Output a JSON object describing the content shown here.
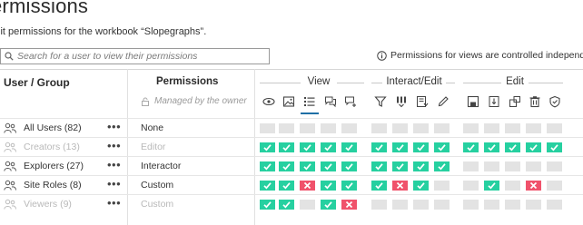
{
  "page": {
    "title": "ermissions",
    "subtitle": "lit permissions for the workbook “Slopegraphs”."
  },
  "search": {
    "placeholder": "Search for a user to view their permissions"
  },
  "notice": "Permissions for views are controlled independently",
  "table": {
    "user_group_header": "User / Group",
    "permissions_header": "Permissions",
    "managed_by_owner": "Managed by the owner",
    "categories": [
      {
        "label": "View"
      },
      {
        "label": "Interact/Edit"
      },
      {
        "label": "Edit"
      }
    ],
    "capabilities": [
      "view-icon",
      "image-icon",
      "filter-list-icon",
      "comments-icon",
      "add-comment-icon",
      "filter-icon",
      "columns-icon",
      "download-data-icon",
      "web-edit-icon",
      "save-icon",
      "download-workbook-icon",
      "move-icon",
      "delete-icon",
      "permissions-icon"
    ],
    "rows": [
      {
        "icon": "group-icon",
        "name": "All Users (82)",
        "role": "None",
        "dim": false,
        "cells": [
          "none",
          "none",
          "none",
          "none",
          "none",
          "none",
          "none",
          "none",
          "none",
          "none",
          "none",
          "none",
          "none",
          "none"
        ]
      },
      {
        "icon": "group-icon",
        "name": "Creators (13)",
        "role": "Editor",
        "dim": true,
        "cells": [
          "allow",
          "allow",
          "allow",
          "allow",
          "allow",
          "allow",
          "allow",
          "allow",
          "allow",
          "allow",
          "allow",
          "allow",
          "allow",
          "allow"
        ]
      },
      {
        "icon": "group-icon",
        "name": "Explorers (27)",
        "role": "Interactor",
        "dim": false,
        "cells": [
          "allow",
          "allow",
          "allow",
          "allow",
          "allow",
          "allow",
          "allow",
          "allow",
          "allow",
          "none",
          "none",
          "none",
          "none",
          "none"
        ]
      },
      {
        "icon": "group-icon",
        "name": "Site Roles (8)",
        "role": "Custom",
        "dim": false,
        "cells": [
          "allow",
          "allow",
          "deny",
          "allow",
          "allow",
          "allow",
          "deny",
          "allow",
          "none",
          "none",
          "allow",
          "none",
          "deny",
          "none"
        ]
      },
      {
        "icon": "group-icon",
        "name": "Viewers (9)",
        "role": "Custom",
        "dim": true,
        "cells": [
          "allow",
          "allow",
          "none",
          "allow",
          "deny",
          "none",
          "none",
          "none",
          "none",
          "none",
          "none",
          "none",
          "none",
          "none"
        ]
      }
    ]
  },
  "colors": {
    "allow": "#26d0a0",
    "deny": "#f0526b",
    "unspecified": "#e3e3e3",
    "accent": "#1f6fa6"
  }
}
